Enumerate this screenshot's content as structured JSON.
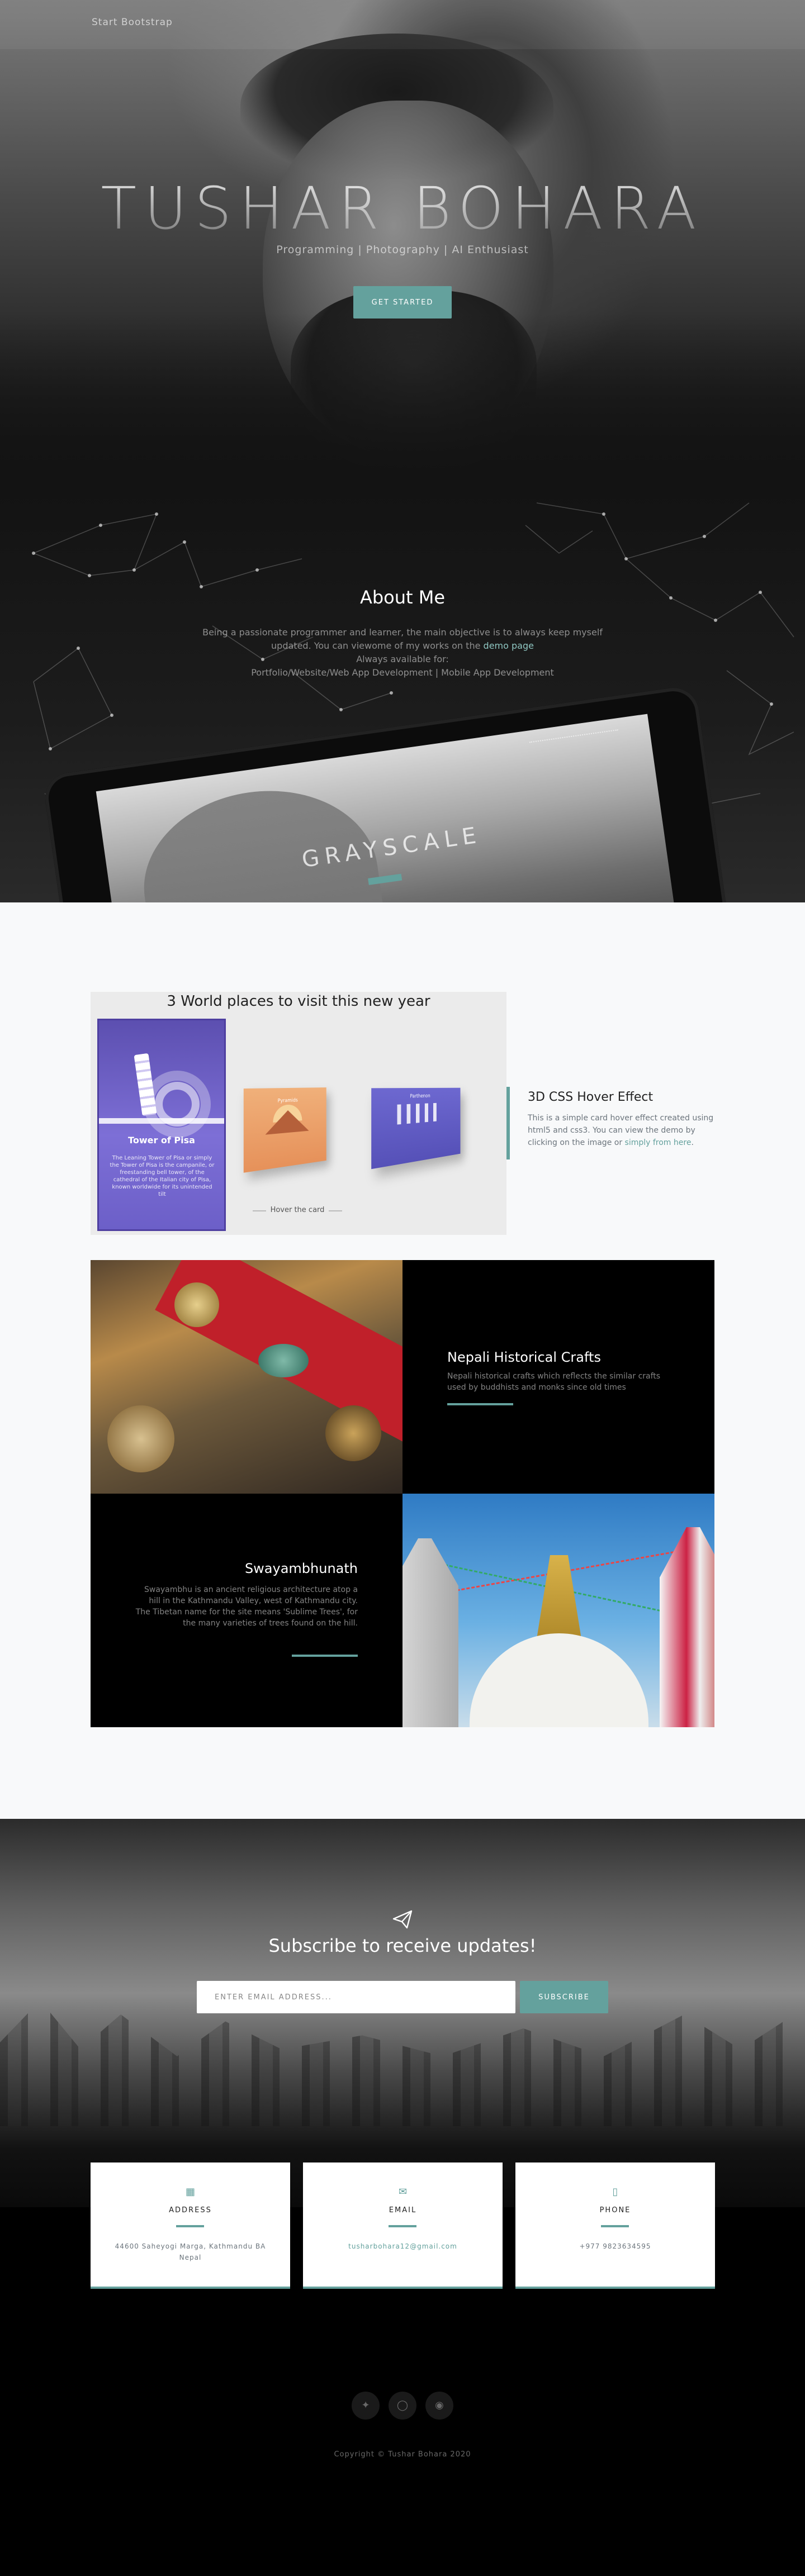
{
  "nav": {
    "brand": "Start Bootstrap"
  },
  "hero": {
    "title": "TUSHAR BOHARA",
    "subtitle": "Programming | Photography | AI Enthusiast",
    "button": "GET STARTED"
  },
  "about": {
    "title": "About Me",
    "line1": "Being a passionate programmer and learner, the main objective is to always keep myself",
    "line2_pre": "updated. You can viewome of my works on the ",
    "line2_link": "demo page",
    "line3": "Always available for:",
    "line4": "Portfolio/Website/Web App Development | Mobile App Development",
    "tablet_title": "GRAYSCALE"
  },
  "featured": {
    "heading": "3 World places to visit this new year",
    "card_big_title": "Tower of Pisa",
    "card_big_text": "The Leaning Tower of Pisa or simply the Tower of Pisa is the campanile, or freestanding bell tower, of the cathedral of the Italian city of Pisa, known worldwide for its unintended tilt",
    "card_orange_label": "Pyramids",
    "card_blue_label": "Parthenon",
    "hover_label": "Hover the card",
    "side_title": "3D CSS Hover Effect",
    "side_text": "This is a simple card hover effect created using html5 and css3. You can view the demo by clicking on the image or ",
    "side_link": "simply from here",
    "side_end": "."
  },
  "projects": [
    {
      "title": "Nepali Historical Crafts",
      "text": "Nepali historical crafts which reflects the similar crafts used by buddhists and monks since old times"
    },
    {
      "title": "Swayambhunath",
      "text": "Swayambhu is an ancient religious architecture atop a hill in the Kathmandu Valley, west of Kathmandu city. The Tibetan name for the site means 'Sublime Trees', for the many varieties of trees found on the hill."
    }
  ],
  "signup": {
    "icon": "paper-plane-icon",
    "title": "Subscribe to receive updates!",
    "placeholder": "ENTER EMAIL ADDRESS...",
    "button": "SUBSCRIBE"
  },
  "contact": {
    "cards": [
      {
        "icon": "map-icon",
        "title": "ADDRESS",
        "value": "44600 Saheyogi Marga, Kathmandu BA Nepal"
      },
      {
        "icon": "envelope-icon",
        "title": "EMAIL",
        "value": "tusharbohara12@gmail.com"
      },
      {
        "icon": "mobile-icon",
        "title": "PHONE",
        "value": "+977 9823634595"
      }
    ],
    "social": [
      "twitter-icon",
      "instagram-icon",
      "github-icon"
    ],
    "copyright": "Copyright © Tushar Bohara 2020"
  },
  "colors": {
    "accent": "#64a19d",
    "dark": "#000000",
    "light_bg": "#f8f9fa"
  }
}
